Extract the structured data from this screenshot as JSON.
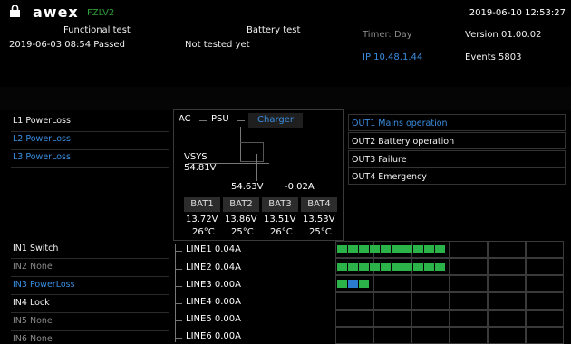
{
  "header": {
    "logo": "awex",
    "model": "FZLV2",
    "datetime": "2019-06-10 12:53:27",
    "functional_test_label": "Functional test",
    "functional_test_value": "2019-06-03 08:54 Passed",
    "battery_test_label": "Battery test",
    "battery_test_value": "Not tested yet",
    "timer": "Timer: Day",
    "version": "Version 01.00.02",
    "ip": "IP 10.48.1.44",
    "events": "Events 5803"
  },
  "left_panel": {
    "items": [
      {
        "label": "L1 PowerLoss",
        "color": "#f2f2f2"
      },
      {
        "label": "L2 PowerLoss",
        "color": "#3a8ee0"
      },
      {
        "label": "L3 PowerLoss",
        "color": "#3a8ee0"
      }
    ],
    "inputs": [
      {
        "label": "IN1 Switch",
        "color": "#f2f2f2"
      },
      {
        "label": "IN2 None",
        "color": "#8a8a8a"
      },
      {
        "label": "IN3 PowerLoss",
        "color": "#3a8ee0"
      },
      {
        "label": "IN4 Lock",
        "color": "#f2f2f2"
      },
      {
        "label": "IN5 None",
        "color": "#8a8a8a"
      },
      {
        "label": "IN6 None",
        "color": "#8a8a8a"
      }
    ]
  },
  "diagram": {
    "ac": "AC",
    "psu": "PSU",
    "charger": "Charger",
    "vsys_label": "VSYS",
    "vsys_value": "54.81V",
    "bus_voltage": "54.63V",
    "bus_current": "-0.02A",
    "batteries": [
      {
        "name": "BAT1",
        "voltage": "13.72V",
        "temp": "26°C"
      },
      {
        "name": "BAT2",
        "voltage": "13.86V",
        "temp": "25°C"
      },
      {
        "name": "BAT3",
        "voltage": "13.51V",
        "temp": "26°C"
      },
      {
        "name": "BAT4",
        "voltage": "13.53V",
        "temp": "25°C"
      }
    ],
    "lines": [
      "LINE1 0.04A",
      "LINE2 0.04A",
      "LINE3 0.00A",
      "LINE4 0.00A",
      "LINE5 0.00A",
      "LINE6 0.00A"
    ]
  },
  "right_panel": {
    "outputs": [
      {
        "label": "OUT1 Mains operation",
        "color": "#3a8ee0"
      },
      {
        "label": "OUT2 Battery operation",
        "color": "#f2f2f2"
      },
      {
        "label": "OUT3 Failure",
        "color": "#f2f2f2"
      },
      {
        "label": "OUT4 Emergency",
        "color": "#f2f2f2"
      }
    ],
    "line_blocks": [
      {
        "count": 10,
        "color": "#2bb34a"
      },
      {
        "count": 10,
        "color": "#2bb34a"
      },
      {
        "count": 3,
        "color": "#2bb34a"
      },
      {
        "count": 0,
        "color": "#2bb34a"
      },
      {
        "count": 0,
        "color": "#2bb34a"
      },
      {
        "count": 0,
        "color": "#2bb34a"
      }
    ]
  }
}
